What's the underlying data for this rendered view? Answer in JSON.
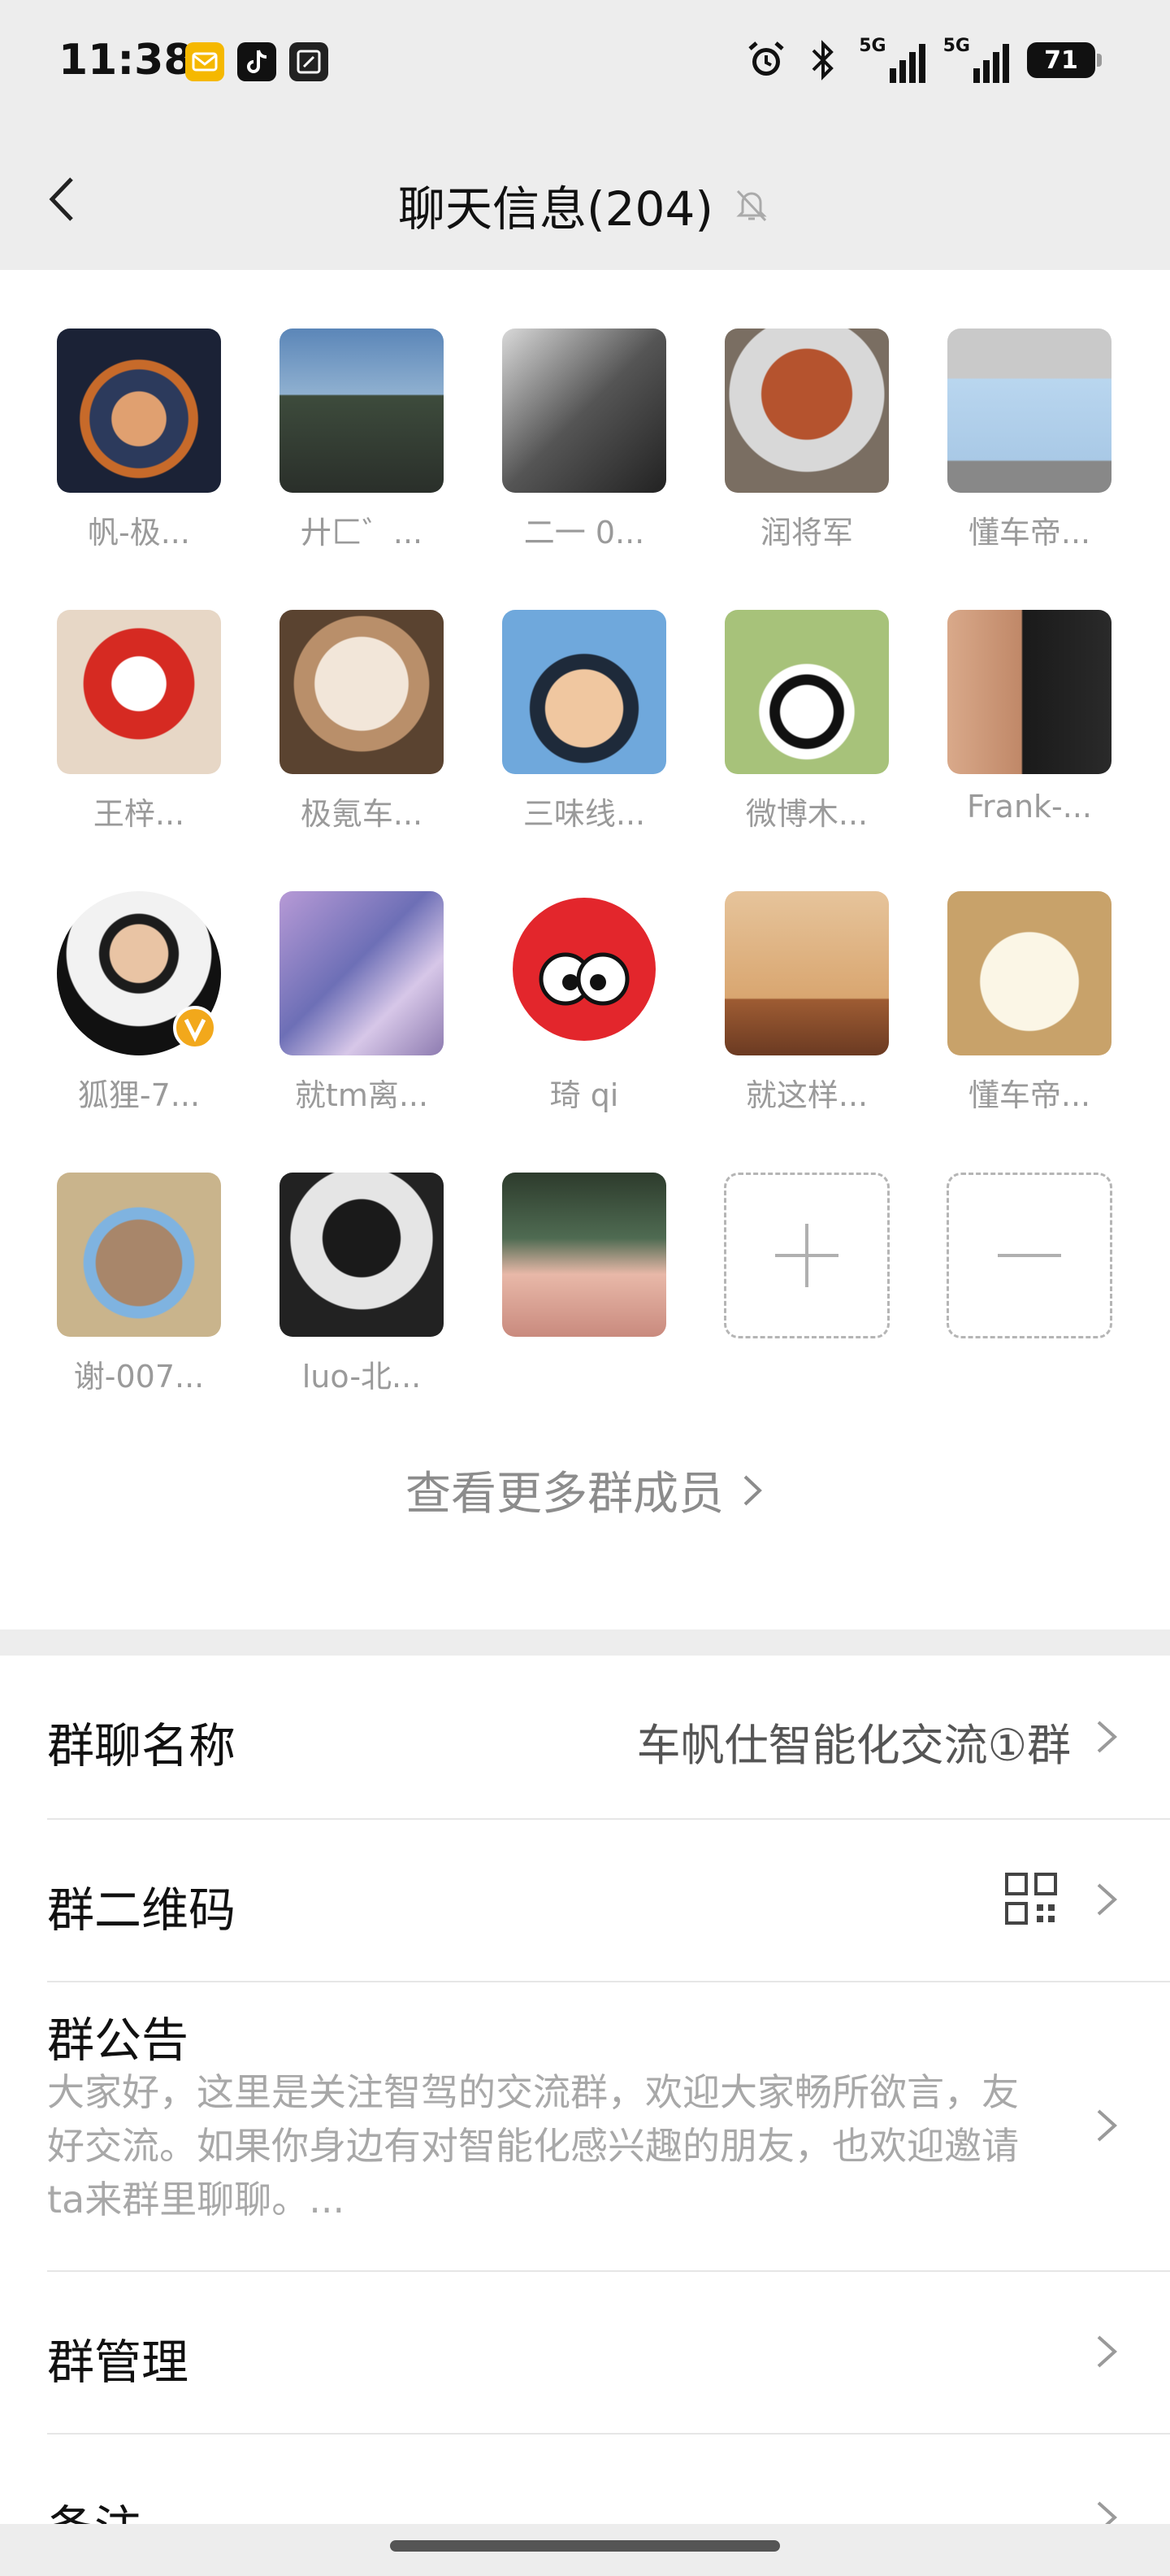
{
  "status_bar": {
    "time": "11:38",
    "net1": "5G",
    "net2": "5G",
    "battery": "71"
  },
  "header": {
    "title": "聊天信息(204)"
  },
  "members": [
    {
      "name": "帆-极..."
    },
    {
      "name": "廾匚゛..."
    },
    {
      "name": "二一 0..."
    },
    {
      "name": "润将军"
    },
    {
      "name": "懂车帝..."
    },
    {
      "name": "王梓..."
    },
    {
      "name": "极氪车..."
    },
    {
      "name": "三味线..."
    },
    {
      "name": "微博木..."
    },
    {
      "name": "Frank-..."
    },
    {
      "name": "狐狸-7..."
    },
    {
      "name": "就tm离..."
    },
    {
      "name": "琦 qi"
    },
    {
      "name": "就这样..."
    },
    {
      "name": "懂车帝..."
    },
    {
      "name": "谢-007..."
    },
    {
      "name": "luo-北..."
    }
  ],
  "view_more": "查看更多群成员",
  "settings": {
    "group_name_label": "群聊名称",
    "group_name_value": "车帆仕智能化交流①群",
    "qr_label": "群二维码",
    "notice_label": "群公告",
    "notice_text": "大家好，这里是关注智驾的交流群，欢迎大家畅所欲言，友好交流。如果你身边有对智能化感兴趣的朋友，也欢迎邀请ta来群里聊聊。...",
    "manage_label": "群管理",
    "remark_label": "备注"
  }
}
